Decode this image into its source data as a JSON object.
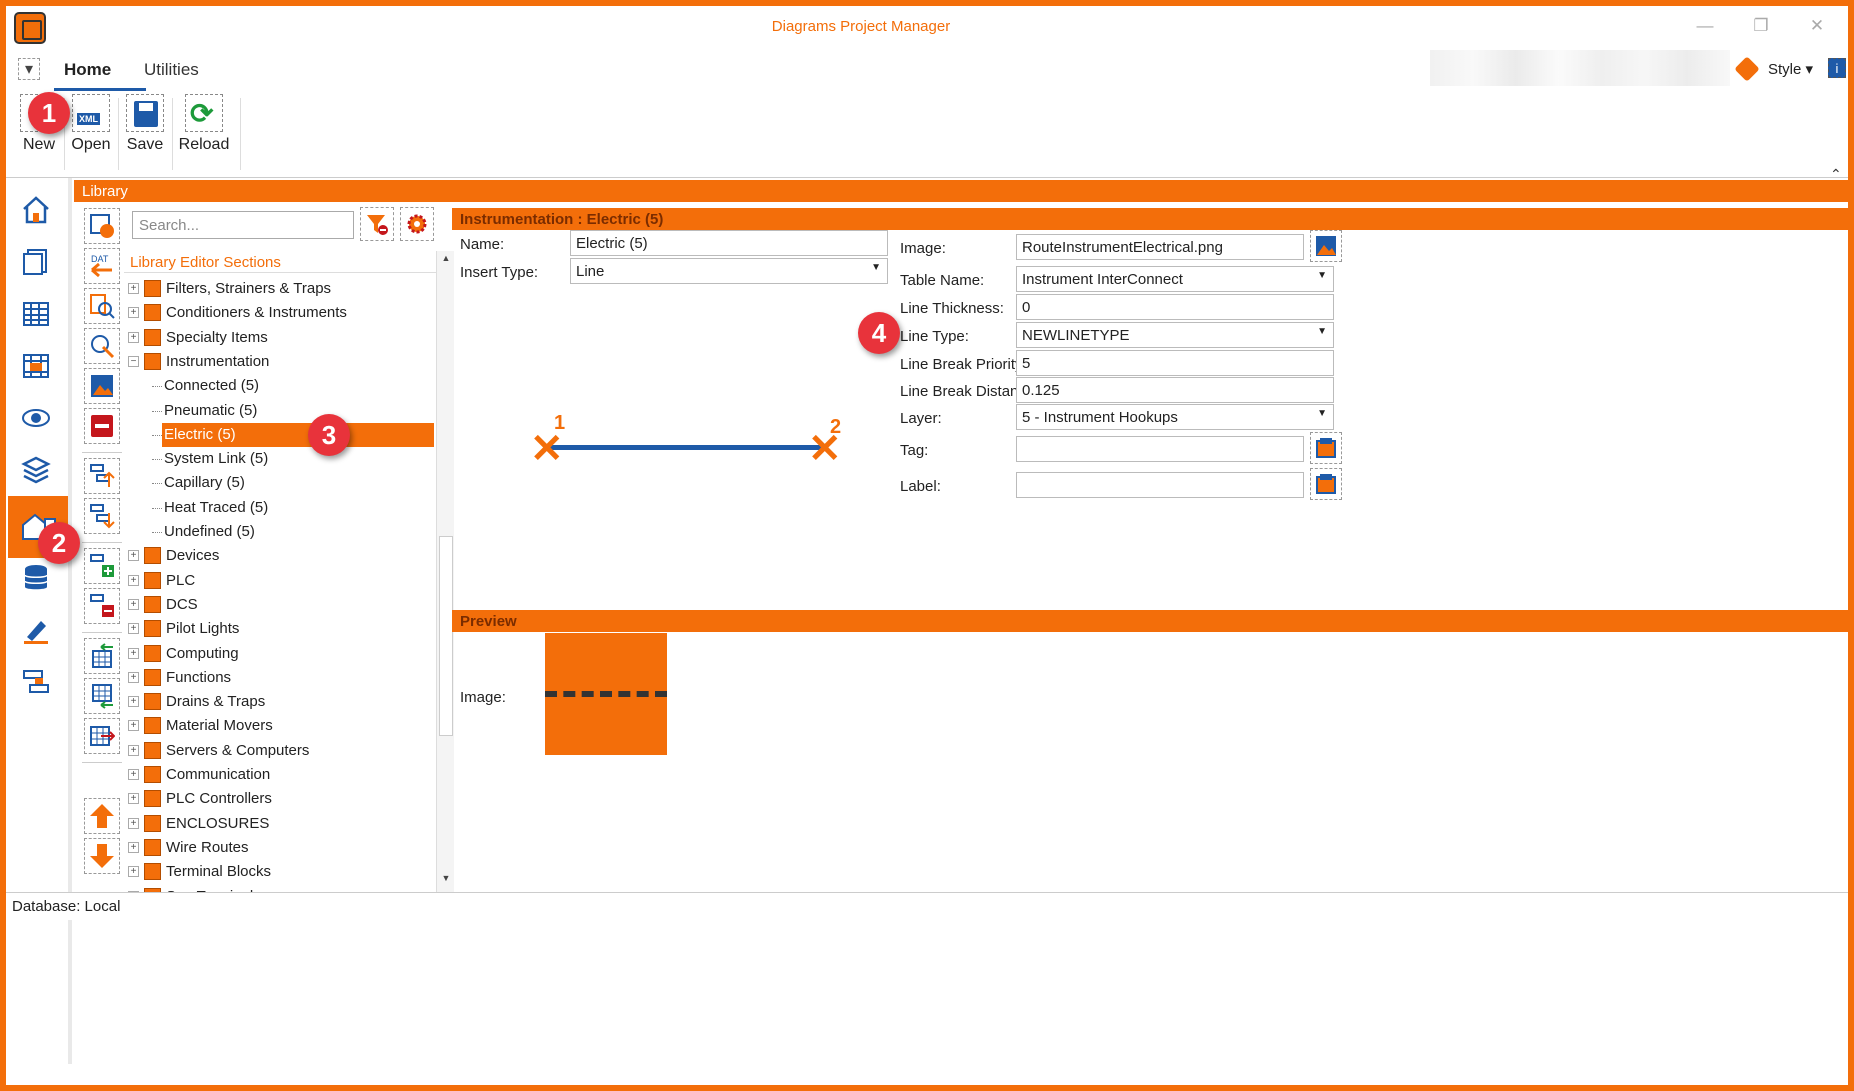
{
  "app": {
    "title": "Diagrams Project Manager"
  },
  "tabs": {
    "home": "Home",
    "utilities": "Utilities"
  },
  "header": {
    "style": "Style"
  },
  "ribbon": {
    "new": "New",
    "open": "Open",
    "save": "Save",
    "reload": "Reload"
  },
  "library": {
    "title": "Library",
    "search_placeholder": "Search...",
    "sections_header": "Library Editor Sections"
  },
  "tree": [
    {
      "label": "Filters, Strainers & Traps",
      "type": "group",
      "expanded": false
    },
    {
      "label": "Conditioners & Instruments",
      "type": "group",
      "expanded": false
    },
    {
      "label": "Specialty Items",
      "type": "group",
      "expanded": false
    },
    {
      "label": "Instrumentation",
      "type": "group",
      "expanded": true
    },
    {
      "label": "Connected (5)",
      "type": "child"
    },
    {
      "label": "Pneumatic (5)",
      "type": "child"
    },
    {
      "label": "Electric (5)",
      "type": "child",
      "selected": true
    },
    {
      "label": "System Link (5)",
      "type": "child"
    },
    {
      "label": "Capillary (5)",
      "type": "child"
    },
    {
      "label": "Heat Traced (5)",
      "type": "child"
    },
    {
      "label": "Undefined (5)",
      "type": "child"
    },
    {
      "label": "Devices",
      "type": "group"
    },
    {
      "label": "PLC",
      "type": "group"
    },
    {
      "label": "DCS",
      "type": "group"
    },
    {
      "label": "Pilot Lights",
      "type": "group"
    },
    {
      "label": "Computing",
      "type": "group"
    },
    {
      "label": "Functions",
      "type": "group"
    },
    {
      "label": "Drains & Traps",
      "type": "group"
    },
    {
      "label": "Material Movers",
      "type": "group"
    },
    {
      "label": "Servers & Computers",
      "type": "group"
    },
    {
      "label": "Communication",
      "type": "group"
    },
    {
      "label": "PLC Controllers",
      "type": "group"
    },
    {
      "label": "ENCLOSURES",
      "type": "group"
    },
    {
      "label": "Wire Routes",
      "type": "group"
    },
    {
      "label": "Terminal Blocks",
      "type": "group"
    },
    {
      "label": "Seg Terminals",
      "type": "group"
    }
  ],
  "editor": {
    "header": "Instrumentation : Electric (5)",
    "name_label": "Name:",
    "name_value": "Electric (5)",
    "insert_type_label": "Insert Type:",
    "insert_type_value": "Line",
    "image_label": "Image:",
    "image_value": "RouteInstrumentElectrical.png",
    "table_name_label": "Table Name:",
    "table_name_value": "Instrument InterConnect",
    "line_thickness_label": "Line Thickness:",
    "line_thickness_value": "0",
    "line_type_label": "Line Type:",
    "line_type_value": "NEWLINETYPE",
    "line_break_priority_label": "Line Break Priority:",
    "line_break_priority_value": "5",
    "line_break_distance_label": "Line Break Distan...",
    "line_break_distance_value": "0.125",
    "layer_label": "Layer:",
    "layer_value": "5 - Instrument Hookups",
    "tag_label": "Tag:",
    "tag_value": "",
    "label_label": "Label:",
    "label_value": "",
    "point1": "1",
    "point2": "2"
  },
  "preview": {
    "header": "Preview",
    "image_label": "Image:"
  },
  "status": {
    "text": "Database: Local"
  },
  "badges": {
    "b1": "1",
    "b2": "2",
    "b3": "3",
    "b4": "4"
  },
  "colors": {
    "accent": "#f36e0a",
    "badge": "#e8333b",
    "line": "#1e5aa8"
  }
}
